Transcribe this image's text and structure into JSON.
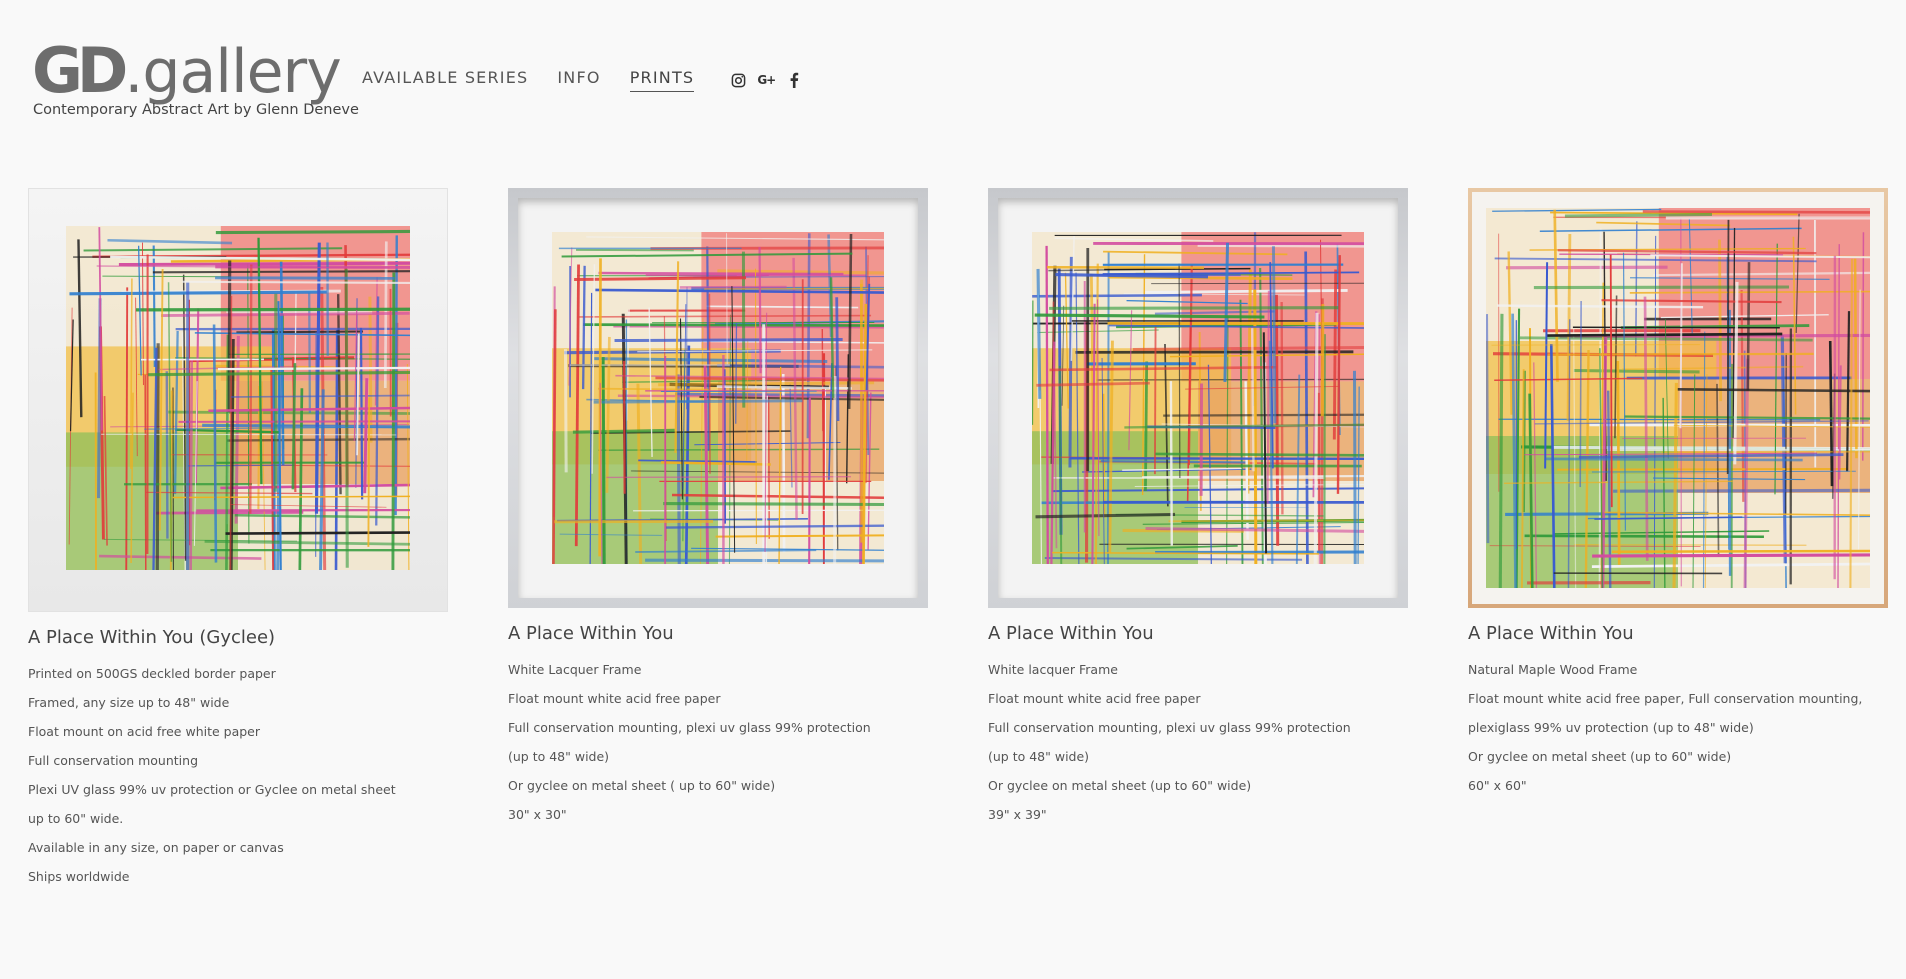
{
  "header": {
    "logo_mark": "GD",
    "logo_word": ".gallery",
    "tagline": "Contemporary Abstract Art by Glenn Deneve",
    "nav": [
      {
        "label": "AVAILABLE SERIES",
        "active": false
      },
      {
        "label": "INFO",
        "active": false
      },
      {
        "label": "PRINTS",
        "active": true
      }
    ],
    "social": [
      {
        "icon": "instagram-icon"
      },
      {
        "icon": "google-plus-icon",
        "glyph": "G+"
      },
      {
        "icon": "facebook-icon"
      }
    ]
  },
  "items": [
    {
      "title": "A Place Within You (Gyclee)",
      "frame": "white",
      "lines": [
        "Printed on 500GS deckled border paper",
        "Framed, any size up to 48\" wide",
        "Float mount on acid free white paper",
        "Full conservation mounting",
        "Plexi UV glass 99% uv protection or Gyclee on metal sheet",
        "up to 60\" wide.",
        "Available in any size, on paper or canvas",
        "Ships worldwide"
      ]
    },
    {
      "title": "A Place Within You",
      "frame": "lacquer",
      "lines": [
        "White Lacquer Frame",
        "Float mount white acid free paper",
        "Full conservation mounting, plexi uv glass 99% protection",
        "(up to 48\" wide)",
        "Or gyclee on metal sheet ( up to 60\" wide)",
        "30\" x 30\""
      ]
    },
    {
      "title": "A Place Within You",
      "frame": "lacquer",
      "lines": [
        "White lacquer Frame",
        "Float mount white acid free paper",
        "Full conservation mounting, plexi uv glass 99% protection",
        "(up to 48\" wide)",
        "Or gyclee on metal sheet (up to 60\" wide)",
        "39\" x 39\""
      ]
    },
    {
      "title": "A Place Within You",
      "frame": "maple",
      "lines": [
        "Natural Maple Wood Frame",
        "Float mount white acid free paper, Full conservation mounting,",
        "plexiglass 99% uv protection (up to 48\" wide)",
        "Or gyclee on metal sheet (up to 60\" wide)",
        "60\" x 60\""
      ]
    }
  ]
}
